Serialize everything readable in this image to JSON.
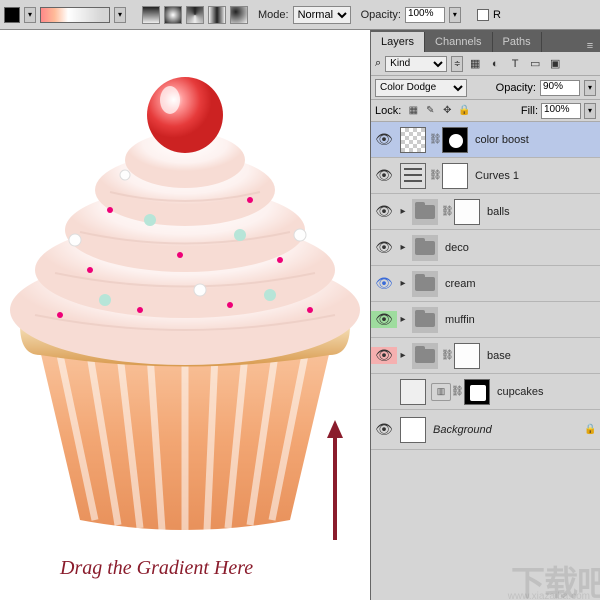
{
  "toolbar": {
    "mode_label": "Mode:",
    "mode_value": "Normal",
    "opacity_label": "Opacity:",
    "opacity_value": "100%",
    "r_tail": "R"
  },
  "panel": {
    "tabs": {
      "layers": "Layers",
      "channels": "Channels",
      "paths": "Paths"
    },
    "filter": {
      "kind_label": "Kind",
      "kind_sel": "⌕"
    },
    "blend": {
      "mode": "Color Dodge",
      "opacity_label": "Opacity:",
      "opacity_value": "90%"
    },
    "lock": {
      "label": "Lock:",
      "fill_label": "Fill:",
      "fill_value": "100%"
    },
    "layers": [
      {
        "name": "color boost"
      },
      {
        "name": "Curves 1"
      },
      {
        "name": "balls"
      },
      {
        "name": "deco"
      },
      {
        "name": "cream"
      },
      {
        "name": "muffin"
      },
      {
        "name": "base"
      },
      {
        "name": "cupcakes"
      },
      {
        "name": "Background"
      }
    ]
  },
  "canvas": {
    "instruction": "Drag the Gradient Here"
  },
  "watermark": {
    "main": "下载吧",
    "sub": "www.xiazaiba.com"
  }
}
